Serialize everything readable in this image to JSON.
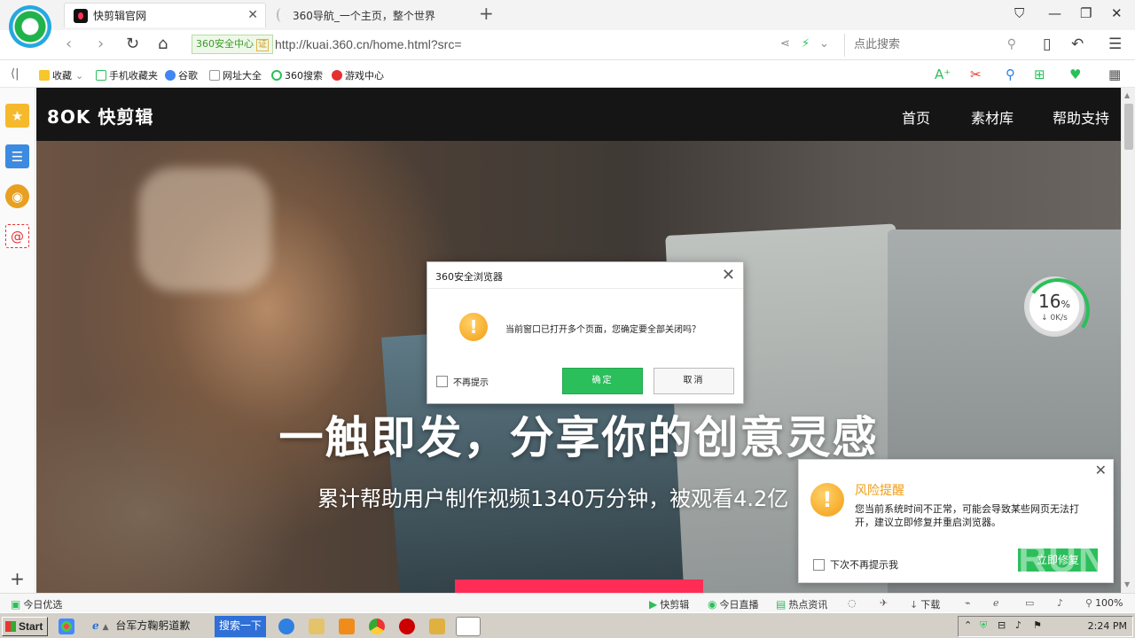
{
  "browser": {
    "tabs": [
      {
        "label": "快剪辑官网",
        "active": true
      },
      {
        "label": "360导航_一个主页，整个世界",
        "active": false
      }
    ],
    "address": {
      "security_badge": "360安全中心",
      "verified_mark": "证",
      "url": "http://kuai.360.cn/home.html?src=",
      "search_placeholder": "点此搜索"
    },
    "bookmarks": [
      "收藏",
      "手机收藏夹",
      "谷歌",
      "网址大全",
      "360搜索",
      "游戏中心"
    ]
  },
  "site": {
    "logo": "8OK 快剪辑",
    "nav": [
      "首页",
      "素材库",
      "帮助支持"
    ],
    "hero_title": "一触即发，分享你的创意灵感",
    "hero_subtitle": "累计帮助用户制作视频1340万分钟，被观看4.2亿"
  },
  "speed_widget": {
    "percent": "16",
    "percent_sign": "%",
    "rate": "0K/s"
  },
  "dialog": {
    "title": "360安全浏览器",
    "message": "当前窗口已打开多个页面，您确定要全部关闭吗？",
    "checkbox_label": "不再提示",
    "ok_label": "确定",
    "cancel_label": "取消"
  },
  "risk_popup": {
    "title": "风险提醒",
    "body": "您当前系统时间不正常，可能会导致某些网页无法打开，建议立即修复并重启浏览器。",
    "checkbox_label": "下次不再提示我",
    "fix_label": "立即修复"
  },
  "watermark": "ANY RUN",
  "statusbar": {
    "left": "今日优选",
    "items": [
      "快剪辑",
      "今日直播",
      "热点资讯",
      "下载"
    ],
    "zoom": "100%"
  },
  "taskbar": {
    "start": "Start",
    "items": [
      "台军方鞠躬道歉",
      "搜索一下"
    ],
    "clock": "2:24 PM"
  }
}
